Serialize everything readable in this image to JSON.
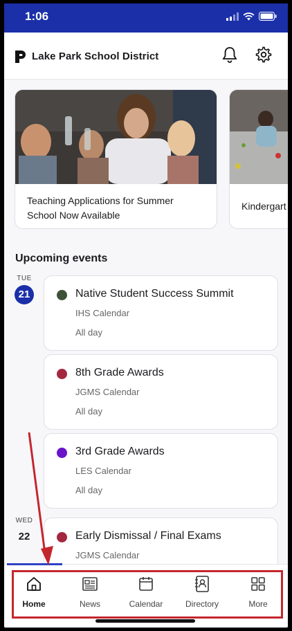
{
  "status_bar": {
    "time": "1:06"
  },
  "header": {
    "district_name": "Lake Park School District"
  },
  "news": [
    {
      "title": "Teaching Applications for Summer School Now Available"
    },
    {
      "title": "Kindergart"
    }
  ],
  "events_section": {
    "title": "Upcoming events"
  },
  "days": [
    {
      "dow": "TUE",
      "num": "21"
    },
    {
      "dow": "WED",
      "num": "22"
    }
  ],
  "events": [
    {
      "name": "Native Student Success Summit",
      "calendar": "IHS Calendar",
      "time": "All day",
      "color": "#3d5238"
    },
    {
      "name": "8th Grade Awards",
      "calendar": "JGMS Calendar",
      "time": "All day",
      "color": "#a3283f"
    },
    {
      "name": "3rd Grade Awards",
      "calendar": "LES Calendar",
      "time": "All day",
      "color": "#6a13c9"
    },
    {
      "name": "Early Dismissal / Final Exams",
      "calendar": "JGMS Calendar",
      "time": "",
      "color": "#a3283f"
    }
  ],
  "tabs": [
    {
      "label": "Home",
      "icon": "home-icon"
    },
    {
      "label": "News",
      "icon": "news-icon"
    },
    {
      "label": "Calendar",
      "icon": "calendar-icon"
    },
    {
      "label": "Directory",
      "icon": "directory-icon"
    },
    {
      "label": "More",
      "icon": "grid-icon"
    }
  ],
  "colors": {
    "brand": "#1a2fa8",
    "annotation": "#c4262e"
  }
}
